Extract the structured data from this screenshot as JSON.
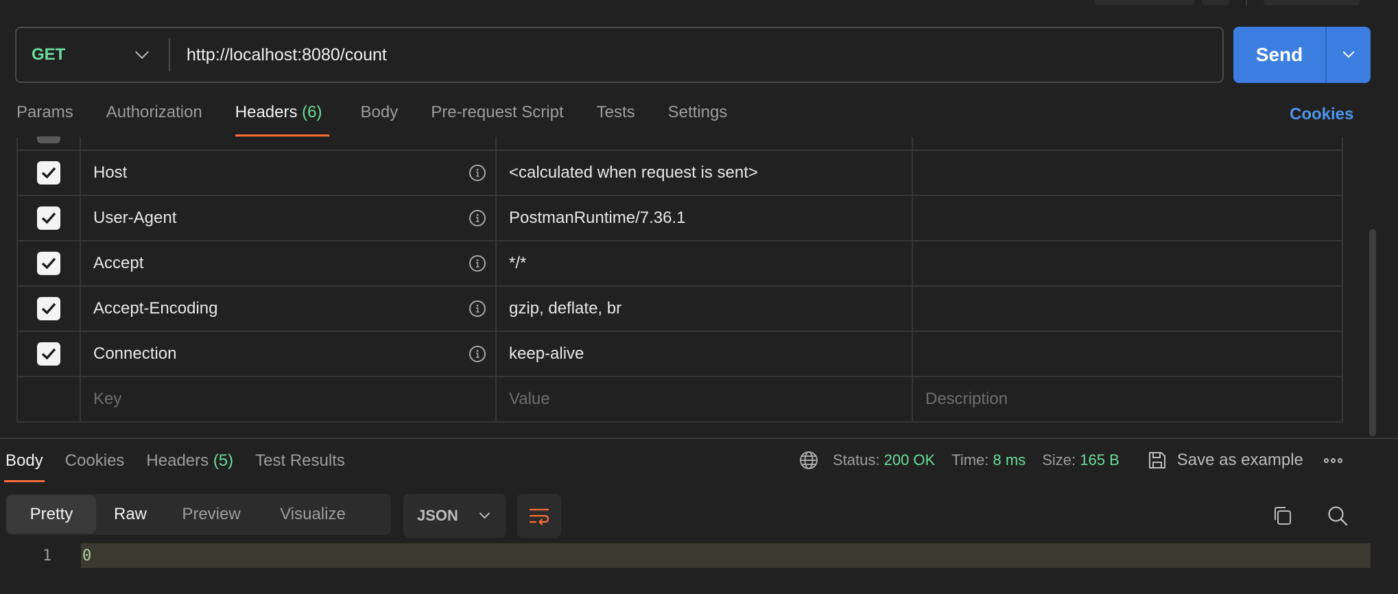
{
  "request": {
    "method": "GET",
    "url": "http://localhost:8080/count",
    "send_label": "Send"
  },
  "request_tabs": [
    {
      "label": "Params"
    },
    {
      "label": "Authorization"
    },
    {
      "label": "Headers",
      "count": "(6)",
      "active": true
    },
    {
      "label": "Body"
    },
    {
      "label": "Pre-request Script"
    },
    {
      "label": "Tests"
    },
    {
      "label": "Settings"
    }
  ],
  "cookies_link": "Cookies",
  "headers_table": {
    "rows": [
      {
        "key": "Host",
        "value": "<calculated when request is sent>",
        "checked": true
      },
      {
        "key": "User-Agent",
        "value": "PostmanRuntime/7.36.1",
        "checked": true
      },
      {
        "key": "Accept",
        "value": "*/*",
        "checked": true
      },
      {
        "key": "Accept-Encoding",
        "value": "gzip, deflate, br",
        "checked": true
      },
      {
        "key": "Connection",
        "value": "keep-alive",
        "checked": true
      }
    ],
    "placeholders": {
      "key": "Key",
      "value": "Value",
      "description": "Description"
    }
  },
  "response_tabs": [
    {
      "label": "Body",
      "active": true
    },
    {
      "label": "Cookies"
    },
    {
      "label": "Headers",
      "count": "(5)"
    },
    {
      "label": "Test Results"
    }
  ],
  "status": {
    "status_label": "Status:",
    "status_value": "200 OK",
    "time_label": "Time:",
    "time_value": "8 ms",
    "size_label": "Size:",
    "size_value": "165 B",
    "save_example": "Save as example"
  },
  "view_modes": [
    "Pretty",
    "Raw",
    "Preview",
    "Visualize"
  ],
  "format": "JSON",
  "code": [
    {
      "line": "1",
      "text": "0"
    }
  ],
  "colors": {
    "accent": "#ff6c37",
    "send": "#3b7ee0",
    "method": "#6bdd9a",
    "link": "#4f95ec"
  }
}
